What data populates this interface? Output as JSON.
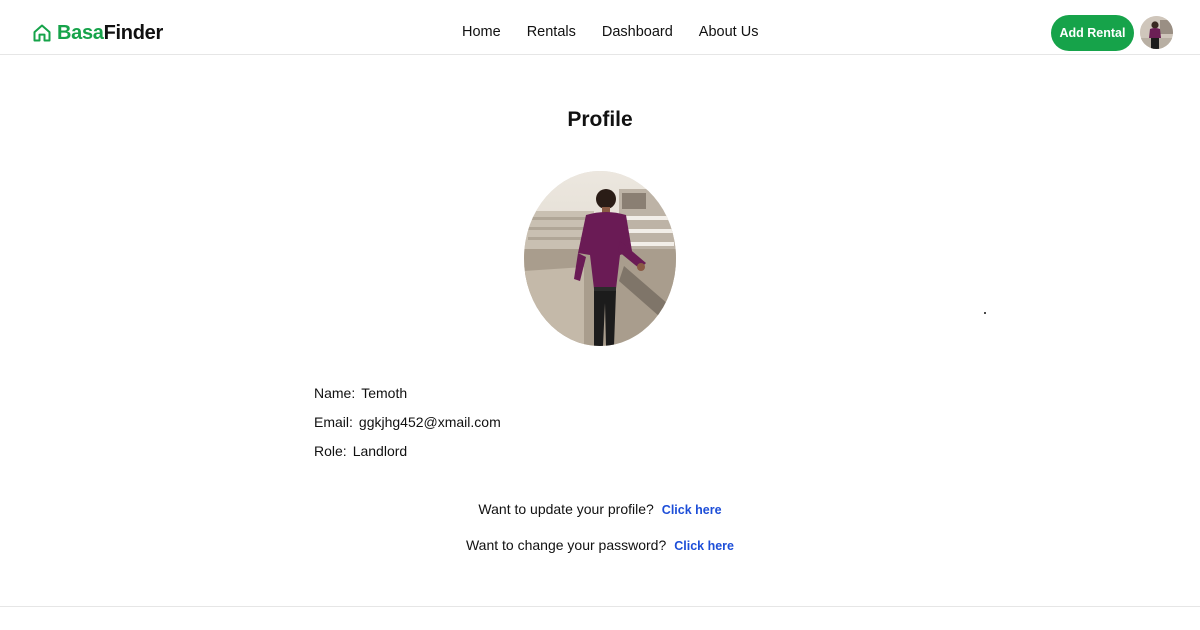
{
  "brand": {
    "part1": "Basa",
    "part2": "Finder",
    "icon": "home-icon",
    "color": "#16a34a"
  },
  "nav": {
    "items": [
      "Home",
      "Rentals",
      "Dashboard",
      "About Us"
    ]
  },
  "header": {
    "add_rental_label": "Add Rental",
    "avatar_icon": "avatar"
  },
  "profile": {
    "title": "Profile",
    "fields": [
      {
        "label": "Name:",
        "value": "Temoth"
      },
      {
        "label": "Email:",
        "value": "ggkjhg452@xmail.com"
      },
      {
        "label": "Role:",
        "value": "Landlord"
      }
    ]
  },
  "actions": {
    "update_text": "Want to update your profile?",
    "update_link": "Click here",
    "password_text": "Want to change your password?",
    "password_link": "Click here",
    "link_color": "#1d4ed8"
  }
}
